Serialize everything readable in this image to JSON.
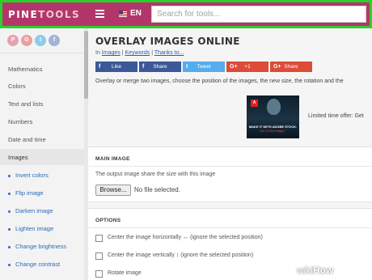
{
  "header": {
    "logo_part1": "PINE",
    "logo_part2": "TOOLS",
    "language": "EN",
    "search_placeholder": "Search for tools...",
    "menu_icon": "hamburger-icon",
    "flag_icon": "us-flag-icon",
    "accent_color": "#b2366a",
    "highlight_color": "#2bd02b"
  },
  "sidebar": {
    "social": [
      {
        "icon": "pinterest-icon",
        "glyph": "P",
        "color": "#e8a0b0"
      },
      {
        "icon": "google-plus-icon",
        "glyph": "G",
        "color": "#e8a0a0"
      },
      {
        "icon": "twitter-icon",
        "glyph": "t",
        "color": "#8ecbe8"
      },
      {
        "icon": "facebook-icon",
        "glyph": "f",
        "color": "#a0b4d8"
      }
    ],
    "categories": [
      "Mathematics",
      "Colors",
      "Text and lists",
      "Numbers",
      "Date and time",
      "Images"
    ],
    "active_category": "Images",
    "subitems": [
      "Invert colors",
      "Flip image",
      "Darken image",
      "Lighten image",
      "Change brightness",
      "Change contrast"
    ]
  },
  "main": {
    "title": "OVERLAY IMAGES ONLINE",
    "breadcrumb": {
      "prefix": "In",
      "link1": "Images",
      "sep1": "|",
      "link2": "Keywords",
      "sep2": "|",
      "link3": "Thanks to..."
    },
    "share_buttons": [
      {
        "label": "Like",
        "icon": "facebook-icon",
        "glyph": "f",
        "color": "#3b5998"
      },
      {
        "label": "Share",
        "icon": "facebook-icon",
        "glyph": "f",
        "color": "#3b5998"
      },
      {
        "label": "Tweet",
        "icon": "twitter-icon",
        "glyph": "t",
        "color": "#55acee"
      },
      {
        "label": "+1",
        "icon": "google-plus-icon",
        "glyph": "G+",
        "color": "#dd4b39"
      },
      {
        "label": "Share",
        "icon": "google-plus-icon",
        "glyph": "G+",
        "color": "#dd4b39"
      }
    ],
    "description": "Overlay or merge two images, choose the position of the images, the new size, the rotation and the",
    "ad": {
      "logo_text": "Adobe",
      "headline": "MAKE IT WITH ADOBE STOCK.",
      "subline": "Get 10 free images ›",
      "offer_text": "Limited time offer: Get"
    }
  },
  "main_image_section": {
    "title": "MAIN IMAGE",
    "help_text": "The output image share the size with this image",
    "browse_label": "Browse...",
    "file_status": "No file selected."
  },
  "options_section": {
    "title": "OPTIONS",
    "options": [
      {
        "label": "Center the image horizontally ↔ (ignore the selected position)",
        "checked": false
      },
      {
        "label": "Center the image vertically ↕ (ignore the selected position)",
        "checked": false
      },
      {
        "label": "Rotate image",
        "checked": false
      }
    ]
  },
  "watermark": {
    "part1": "wiki",
    "part2": "How"
  }
}
